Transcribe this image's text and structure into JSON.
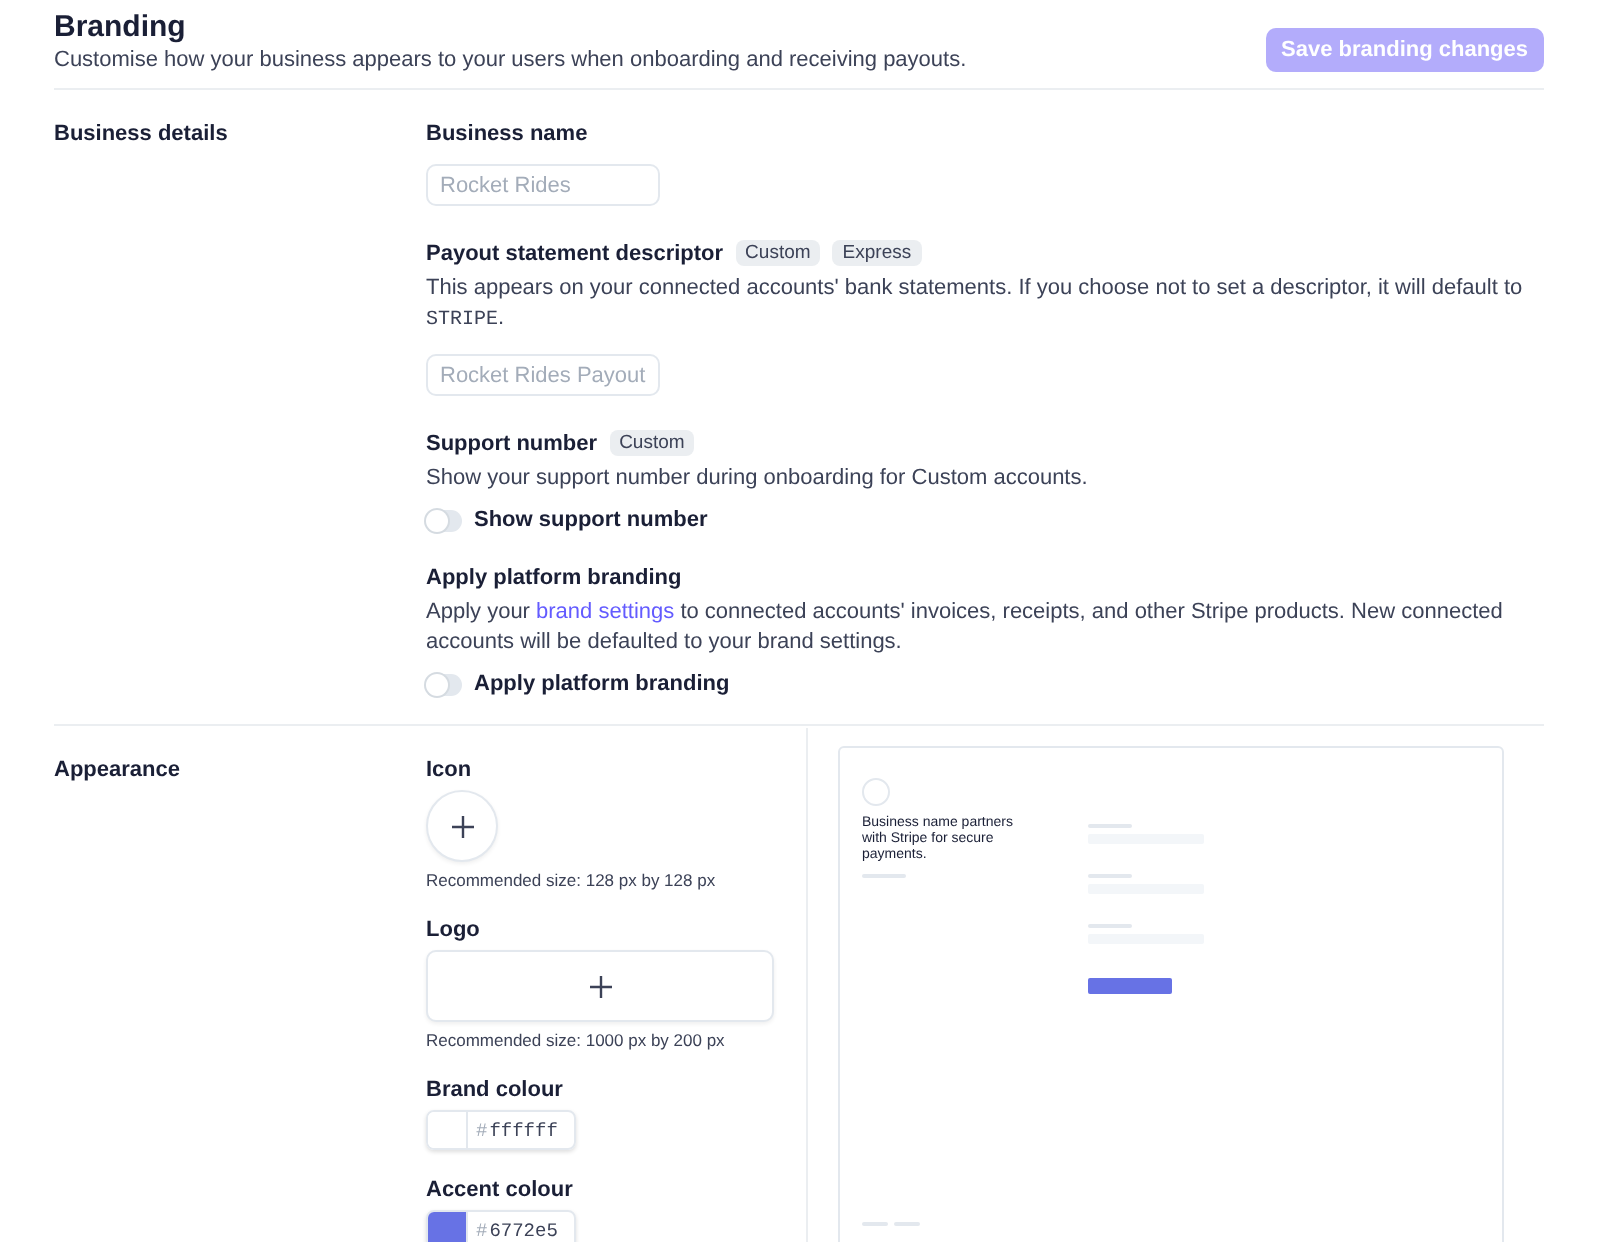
{
  "header": {
    "title": "Branding",
    "subtitle": "Customise how your business appears to your users when onboarding and receiving payouts.",
    "save_button": {
      "label": "Save branding changes",
      "disabled": true
    }
  },
  "business_details": {
    "label": "Business details",
    "business_name": {
      "label": "Business name",
      "placeholder": "Rocket Rides"
    },
    "payout_descriptor": {
      "label": "Payout statement descriptor",
      "badges": [
        "Custom",
        "Express"
      ],
      "description": {
        "before": "This appears on your connected accounts' bank statements. If you choose not to set a descriptor, it will default to ",
        "code": "STRIPE",
        "after": "."
      },
      "placeholder": "Rocket Rides Payout"
    },
    "support_number": {
      "label": "Support number",
      "badges": [
        "Custom"
      ],
      "description": "Show your support number during onboarding for Custom accounts.",
      "toggle": {
        "label": "Show support number",
        "on": false
      }
    },
    "platform_branding": {
      "label": "Apply platform branding",
      "description": {
        "before": "Apply your ",
        "link": "brand settings",
        "after": " to connected accounts' invoices, receipts, and other Stripe products. New connected accounts will be defaulted to your brand settings."
      },
      "toggle": {
        "label": "Apply platform branding",
        "on": false
      }
    }
  },
  "appearance": {
    "label": "Appearance",
    "icon": {
      "label": "Icon",
      "hint": "Recommended size: 128 px by 128 px"
    },
    "logo": {
      "label": "Logo",
      "hint": "Recommended size: 1000 px by 200 px"
    },
    "colours": [
      {
        "label": "Brand colour",
        "prefix": "#",
        "value": "ffffff",
        "color": "#ffffff"
      },
      {
        "label": "Accent colour",
        "prefix": "#",
        "value": "6772e5",
        "color": "#6772e5"
      }
    ],
    "preview": {
      "text": "Business name partners with Stripe for secure payments."
    }
  }
}
